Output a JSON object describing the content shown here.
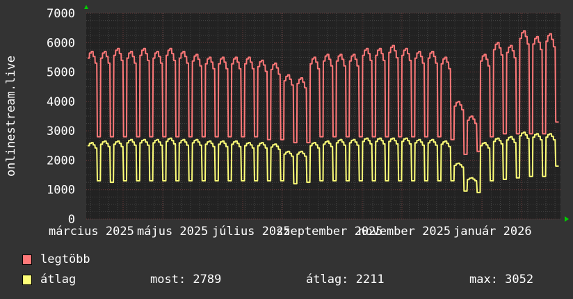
{
  "chart_data": {
    "type": "line",
    "ylabel": "onlinestream.live",
    "ylim": [
      0,
      7000
    ],
    "yticks": [
      0,
      1000,
      2000,
      3000,
      4000,
      5000,
      6000,
      7000
    ],
    "xtick_labels": [
      "március 2025",
      "május 2025",
      "július 2025",
      "szeptember 2025",
      "november 2025",
      "január 2026"
    ],
    "grid": true,
    "background": "#222222",
    "series": [
      {
        "name": "legtöbb",
        "color": "#ff7878",
        "weekly_peak": [
          5700,
          5700,
          5800,
          5700,
          5800,
          5700,
          5800,
          5700,
          5600,
          5500,
          5500,
          5500,
          5500,
          5400,
          5300,
          4900,
          4800,
          5500,
          5600,
          5600,
          5600,
          5800,
          5800,
          5900,
          5800,
          5700,
          5700,
          5500,
          4000,
          3500,
          5600,
          6000,
          5900,
          6400,
          6200,
          6300
        ],
        "weekly_low": [
          2800,
          2800,
          2800,
          2800,
          2800,
          2800,
          2800,
          2800,
          2800,
          2800,
          2800,
          2800,
          2800,
          2700,
          2700,
          2600,
          2600,
          2800,
          2800,
          2800,
          2800,
          2800,
          2800,
          2800,
          2800,
          2800,
          2800,
          2700,
          2200,
          2300,
          2800,
          2900,
          2900,
          2900,
          2900,
          3300
        ]
      },
      {
        "name": "átlag",
        "color": "#ffff78",
        "weekly_peak": [
          2600,
          2650,
          2650,
          2700,
          2700,
          2700,
          2750,
          2700,
          2700,
          2650,
          2650,
          2650,
          2600,
          2600,
          2550,
          2300,
          2300,
          2600,
          2650,
          2700,
          2700,
          2750,
          2750,
          2750,
          2750,
          2700,
          2700,
          2650,
          1900,
          1400,
          2600,
          2750,
          2800,
          2950,
          2900,
          2900
        ],
        "weekly_low": [
          1300,
          1250,
          1300,
          1300,
          1300,
          1300,
          1300,
          1300,
          1300,
          1300,
          1300,
          1300,
          1300,
          1300,
          1300,
          1200,
          1250,
          1300,
          1300,
          1300,
          1300,
          1300,
          1300,
          1300,
          1300,
          1300,
          1300,
          1300,
          950,
          900,
          1300,
          1350,
          1400,
          1450,
          1450,
          1800
        ]
      }
    ]
  },
  "legend": {
    "max_label": "legtöbb",
    "avg_label": "átlag",
    "now": "most: 2789",
    "average": "átlag: 2211",
    "maximum": "max: 3052"
  }
}
